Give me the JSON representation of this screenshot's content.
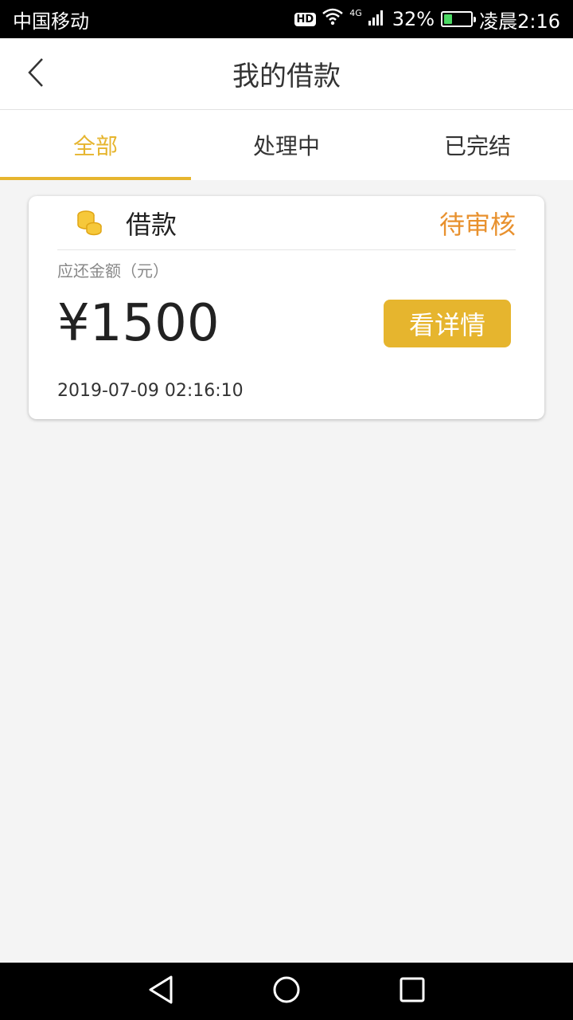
{
  "status_bar": {
    "carrier": "中国移动",
    "hd": "HD",
    "network": "4G",
    "battery_percent": "32%",
    "battery_level": 0.32,
    "time": "凌晨2:16"
  },
  "nav": {
    "title": "我的借款"
  },
  "tabs": [
    {
      "label": "全部",
      "active": true
    },
    {
      "label": "处理中",
      "active": false
    },
    {
      "label": "已完结",
      "active": false
    }
  ],
  "loan_card": {
    "type": "借款",
    "status": "待审核",
    "amount_label": "应还金额（元）",
    "amount": "¥1500",
    "detail_label": "看详情",
    "timestamp": "2019-07-09 02:16:10"
  },
  "colors": {
    "accent": "#e6b52e",
    "status": "#e8912e"
  },
  "icons": {
    "back": "chevron-left-icon",
    "coin": "coins-icon",
    "sys_back": "triangle-back-icon",
    "sys_home": "circle-home-icon",
    "sys_recent": "square-recent-icon"
  }
}
